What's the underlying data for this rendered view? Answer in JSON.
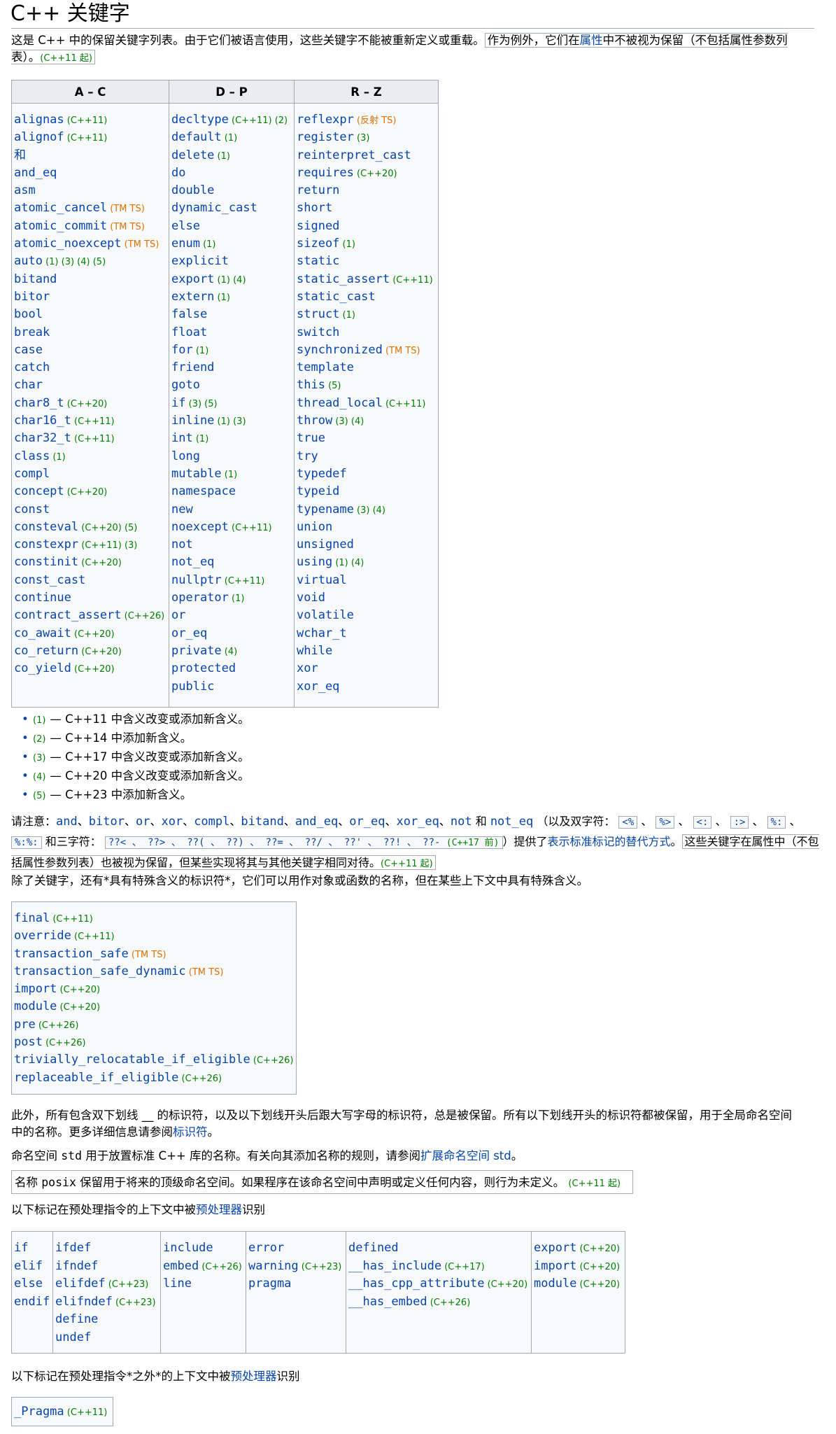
{
  "title": "C++ 关键字",
  "intro": {
    "text_a": "这是 C++ 中的保留关键字列表。由于它们被语言使用，这些关键字不能被重新定义或重载。",
    "text_b1": "作为例外，它们在",
    "text_b_link": "属性",
    "text_b2": "中不被视为保留（不包括属性参数列表）。",
    "since": "(C++11 起)"
  },
  "main_table": {
    "headers": [
      "A – C",
      "D – P",
      "R – Z"
    ],
    "col_ac": [
      {
        "k": "alignas",
        "m": [
          [
            "(C++11)",
            "g"
          ]
        ]
      },
      {
        "k": "alignof",
        "m": [
          [
            "(C++11)",
            "g"
          ]
        ]
      },
      {
        "k": "和",
        "m": []
      },
      {
        "k": "and_eq",
        "m": []
      },
      {
        "k": "asm",
        "m": []
      },
      {
        "k": "atomic_cancel",
        "m": [
          [
            "(TM TS)",
            "o"
          ]
        ]
      },
      {
        "k": "atomic_commit",
        "m": [
          [
            "(TM TS)",
            "o"
          ]
        ]
      },
      {
        "k": "atomic_noexcept",
        "m": [
          [
            "(TM TS)",
            "o"
          ]
        ]
      },
      {
        "k": "auto",
        "m": [
          [
            "(1)",
            "g"
          ],
          [
            "(3)",
            "g"
          ],
          [
            "(4)",
            "g"
          ],
          [
            "(5)",
            "g"
          ]
        ]
      },
      {
        "k": "bitand",
        "m": []
      },
      {
        "k": "bitor",
        "m": []
      },
      {
        "k": "bool",
        "m": []
      },
      {
        "k": "break",
        "m": []
      },
      {
        "k": "case",
        "m": []
      },
      {
        "k": "catch",
        "m": []
      },
      {
        "k": "char",
        "m": []
      },
      {
        "k": "char8_t",
        "m": [
          [
            "(C++20)",
            "g"
          ]
        ]
      },
      {
        "k": "char16_t",
        "m": [
          [
            "(C++11)",
            "g"
          ]
        ]
      },
      {
        "k": "char32_t",
        "m": [
          [
            "(C++11)",
            "g"
          ]
        ]
      },
      {
        "k": "class",
        "m": [
          [
            "(1)",
            "g"
          ]
        ]
      },
      {
        "k": "compl",
        "m": []
      },
      {
        "k": "concept",
        "m": [
          [
            "(C++20)",
            "g"
          ]
        ]
      },
      {
        "k": "const",
        "m": []
      },
      {
        "k": "consteval",
        "m": [
          [
            "(C++20)",
            "g"
          ],
          [
            "(5)",
            "g"
          ]
        ]
      },
      {
        "k": "constexpr",
        "m": [
          [
            "(C++11)",
            "g"
          ],
          [
            "(3)",
            "g"
          ]
        ]
      },
      {
        "k": "constinit",
        "m": [
          [
            "(C++20)",
            "g"
          ]
        ]
      },
      {
        "k": "const_cast",
        "m": []
      },
      {
        "k": "continue",
        "m": []
      },
      {
        "k": "contract_assert",
        "m": [
          [
            "(C++26)",
            "g"
          ]
        ]
      },
      {
        "k": "co_await",
        "m": [
          [
            "(C++20)",
            "g"
          ]
        ]
      },
      {
        "k": "co_return",
        "m": [
          [
            "(C++20)",
            "g"
          ]
        ]
      },
      {
        "k": "co_yield",
        "m": [
          [
            "(C++20)",
            "g"
          ]
        ]
      }
    ],
    "col_dp": [
      {
        "k": "decltype",
        "m": [
          [
            "(C++11)",
            "g"
          ],
          [
            "(2)",
            "g"
          ]
        ]
      },
      {
        "k": "default",
        "m": [
          [
            "(1)",
            "g"
          ]
        ]
      },
      {
        "k": "delete",
        "m": [
          [
            "(1)",
            "g"
          ]
        ]
      },
      {
        "k": "do",
        "m": []
      },
      {
        "k": "double",
        "m": []
      },
      {
        "k": "dynamic_cast",
        "m": []
      },
      {
        "k": "else",
        "m": []
      },
      {
        "k": "enum",
        "m": [
          [
            "(1)",
            "g"
          ]
        ]
      },
      {
        "k": "explicit",
        "m": []
      },
      {
        "k": "export",
        "m": [
          [
            "(1)",
            "g"
          ],
          [
            "(4)",
            "g"
          ]
        ]
      },
      {
        "k": "extern",
        "m": [
          [
            "(1)",
            "g"
          ]
        ]
      },
      {
        "k": "false",
        "m": []
      },
      {
        "k": "float",
        "m": []
      },
      {
        "k": "for",
        "m": [
          [
            "(1)",
            "g"
          ]
        ]
      },
      {
        "k": "friend",
        "m": []
      },
      {
        "k": "goto",
        "m": []
      },
      {
        "k": "if",
        "m": [
          [
            "(3)",
            "g"
          ],
          [
            "(5)",
            "g"
          ]
        ]
      },
      {
        "k": "inline",
        "m": [
          [
            "(1)",
            "g"
          ],
          [
            "(3)",
            "g"
          ]
        ]
      },
      {
        "k": "int",
        "m": [
          [
            "(1)",
            "g"
          ]
        ]
      },
      {
        "k": "long",
        "m": []
      },
      {
        "k": "mutable",
        "m": [
          [
            "(1)",
            "g"
          ]
        ]
      },
      {
        "k": "namespace",
        "m": []
      },
      {
        "k": "new",
        "m": []
      },
      {
        "k": "noexcept",
        "m": [
          [
            "(C++11)",
            "g"
          ]
        ]
      },
      {
        "k": "not",
        "m": []
      },
      {
        "k": "not_eq",
        "m": []
      },
      {
        "k": "nullptr",
        "m": [
          [
            "(C++11)",
            "g"
          ]
        ]
      },
      {
        "k": "operator",
        "m": [
          [
            "(1)",
            "g"
          ]
        ]
      },
      {
        "k": "or",
        "m": []
      },
      {
        "k": "or_eq",
        "m": []
      },
      {
        "k": "private",
        "m": [
          [
            "(4)",
            "g"
          ]
        ]
      },
      {
        "k": "protected",
        "m": []
      },
      {
        "k": "public",
        "m": []
      }
    ],
    "col_rz": [
      {
        "k": "reflexpr",
        "m": [
          [
            "(反射 TS)",
            "o"
          ]
        ]
      },
      {
        "k": "register",
        "m": [
          [
            "(3)",
            "g"
          ]
        ]
      },
      {
        "k": "reinterpret_cast",
        "m": []
      },
      {
        "k": "requires",
        "m": [
          [
            "(C++20)",
            "g"
          ]
        ]
      },
      {
        "k": "return",
        "m": []
      },
      {
        "k": "short",
        "m": []
      },
      {
        "k": "signed",
        "m": []
      },
      {
        "k": "sizeof",
        "m": [
          [
            "(1)",
            "g"
          ]
        ]
      },
      {
        "k": "static",
        "m": []
      },
      {
        "k": "static_assert",
        "m": [
          [
            "(C++11)",
            "g"
          ]
        ]
      },
      {
        "k": "static_cast",
        "m": []
      },
      {
        "k": "struct",
        "m": [
          [
            "(1)",
            "g"
          ]
        ]
      },
      {
        "k": "switch",
        "m": []
      },
      {
        "k": "synchronized",
        "m": [
          [
            "(TM TS)",
            "o"
          ]
        ]
      },
      {
        "k": "template",
        "m": []
      },
      {
        "k": "this",
        "m": [
          [
            "(5)",
            "g"
          ]
        ]
      },
      {
        "k": "thread_local",
        "m": [
          [
            "(C++11)",
            "g"
          ]
        ]
      },
      {
        "k": "throw",
        "m": [
          [
            "(3)",
            "g"
          ],
          [
            "(4)",
            "g"
          ]
        ]
      },
      {
        "k": "true",
        "m": []
      },
      {
        "k": "try",
        "m": []
      },
      {
        "k": "typedef",
        "m": []
      },
      {
        "k": "typeid",
        "m": []
      },
      {
        "k": "typename",
        "m": [
          [
            "(3)",
            "g"
          ],
          [
            "(4)",
            "g"
          ]
        ]
      },
      {
        "k": "union",
        "m": []
      },
      {
        "k": "unsigned",
        "m": []
      },
      {
        "k": "using",
        "m": [
          [
            "(1)",
            "g"
          ],
          [
            "(4)",
            "g"
          ]
        ]
      },
      {
        "k": "virtual",
        "m": []
      },
      {
        "k": "void",
        "m": []
      },
      {
        "k": "volatile",
        "m": []
      },
      {
        "k": "wchar_t",
        "m": []
      },
      {
        "k": "while",
        "m": []
      },
      {
        "k": "xor",
        "m": []
      },
      {
        "k": "xor_eq",
        "m": []
      }
    ]
  },
  "notes": [
    {
      "mark": "(1)",
      "text": "— C++11 中含义改变或添加新含义。"
    },
    {
      "mark": "(2)",
      "text": "— C++14 中添加新含义。"
    },
    {
      "mark": "(3)",
      "text": "— C++17 中含义改变或添加新含义。"
    },
    {
      "mark": "(4)",
      "text": "— C++20 中含义改变或添加新含义。"
    },
    {
      "mark": "(5)",
      "text": "— C++23 中添加新含义。"
    }
  ],
  "alt_tokens": {
    "lead": "请注意：",
    "words": [
      "and",
      "bitor",
      "or",
      "xor",
      "compl",
      "bitand",
      "and_eq",
      "or_eq",
      "xor_eq",
      "not"
    ],
    "and_word": "和",
    "last_word": "not_eq",
    "digraph_intro": "（以及双字符：",
    "digraphs": [
      "<%",
      "%>",
      "<:",
      ":>",
      "%:"
    ],
    "digraph_last": "%:%:",
    "trigraph_intro": "和三字符：",
    "trigraphs": [
      "??<",
      "??>",
      "??(",
      "??)",
      "??=",
      "??/",
      "??'",
      "??!",
      "??-"
    ],
    "trigraph_since": "(C++17 前)",
    "close": "）提供了",
    "link": "表示标准标记的替代方式",
    "boxed": "这些关键字在属性中（不包括属性参数列表）也被视为保留，但某些实现将其与其他关键字相同对待。",
    "since": "(C++11 起)"
  },
  "special_intro": "除了关键字，还有*具有特殊含义的标识符*，它们可以用作对象或函数的名称，但在某些上下文中具有特殊含义。",
  "special_ids": [
    {
      "k": "final",
      "m": [
        [
          "(C++11)",
          "g"
        ]
      ]
    },
    {
      "k": "override",
      "m": [
        [
          "(C++11)",
          "g"
        ]
      ]
    },
    {
      "k": "transaction_safe",
      "m": [
        [
          "(TM TS)",
          "o"
        ]
      ]
    },
    {
      "k": "transaction_safe_dynamic",
      "m": [
        [
          "(TM TS)",
          "o"
        ]
      ]
    },
    {
      "k": "import",
      "m": [
        [
          "(C++20)",
          "g"
        ]
      ]
    },
    {
      "k": "module",
      "m": [
        [
          "(C++20)",
          "g"
        ]
      ]
    },
    {
      "k": "pre",
      "m": [
        [
          "(C++26)",
          "g"
        ]
      ]
    },
    {
      "k": "post",
      "m": [
        [
          "(C++26)",
          "g"
        ]
      ]
    },
    {
      "k": "trivially_relocatable_if_eligible",
      "m": [
        [
          "(C++26)",
          "g"
        ]
      ]
    },
    {
      "k": "replaceable_if_eligible",
      "m": [
        [
          "(C++26)",
          "g"
        ]
      ]
    }
  ],
  "reserved_para": {
    "line1": "此外，所有包含双下划线 __ 的标识符，以及以下划线开头后跟大写字母的标识符，总是被保留。所有以下划线开头的标识符都被保留，用于全局命名空间",
    "line2a": "中的名称。更多详细信息请参阅",
    "link": "标识符",
    "line2b": "。"
  },
  "std_para": {
    "a": "命名空间 ",
    "code": "std",
    "b": " 用于放置标准 C++ 库的名称。有关向其添加名称的规则，请参阅",
    "link": "扩展命名空间 std",
    "c": "。"
  },
  "posix_box": {
    "a": "名称 ",
    "code": "posix",
    "b": " 保留用于将来的顶级命名空间。如果程序在该命名空间中声明或定义任何内容，则行为未定义。",
    "since": "(C++11 起)"
  },
  "preproc_intro": {
    "a": "以下标记在预处理指令的上下文中被",
    "link": "预处理器",
    "b": "识别"
  },
  "preproc_table": [
    [
      {
        "k": "if",
        "m": []
      },
      {
        "k": "elif",
        "m": []
      },
      {
        "k": "else",
        "m": []
      },
      {
        "k": "endif",
        "m": []
      }
    ],
    [
      {
        "k": "ifdef",
        "m": []
      },
      {
        "k": "ifndef",
        "m": []
      },
      {
        "k": "elifdef",
        "m": [
          [
            "(C++23)",
            "g"
          ]
        ]
      },
      {
        "k": "elifndef",
        "m": [
          [
            "(C++23)",
            "g"
          ]
        ]
      },
      {
        "k": "define",
        "m": []
      },
      {
        "k": "undef",
        "m": []
      }
    ],
    [
      {
        "k": "include",
        "m": []
      },
      {
        "k": "embed",
        "m": [
          [
            "(C++26)",
            "g"
          ]
        ]
      },
      {
        "k": "line",
        "m": []
      }
    ],
    [
      {
        "k": "error",
        "m": []
      },
      {
        "k": "warning",
        "m": [
          [
            "(C++23)",
            "g"
          ]
        ]
      },
      {
        "k": "pragma",
        "m": []
      }
    ],
    [
      {
        "k": "defined",
        "m": []
      },
      {
        "k": "__has_include",
        "m": [
          [
            "(C++17)",
            "g"
          ]
        ]
      },
      {
        "k": "__has_cpp_attribute",
        "m": [
          [
            "(C++20)",
            "g"
          ]
        ]
      },
      {
        "k": "__has_embed",
        "m": [
          [
            "(C++26)",
            "g"
          ]
        ]
      }
    ],
    [
      {
        "k": "export",
        "m": [
          [
            "(C++20)",
            "g"
          ]
        ]
      },
      {
        "k": "import",
        "m": [
          [
            "(C++20)",
            "g"
          ]
        ]
      },
      {
        "k": "module",
        "m": [
          [
            "(C++20)",
            "g"
          ]
        ]
      }
    ]
  ],
  "preproc_outside_intro": {
    "a": "以下标记在预处理指令*之外*的上下文中被",
    "link": "预处理器",
    "b": "识别"
  },
  "pragma_box": [
    {
      "k": "_Pragma",
      "m": [
        [
          "(C++11)",
          "g"
        ]
      ]
    }
  ]
}
